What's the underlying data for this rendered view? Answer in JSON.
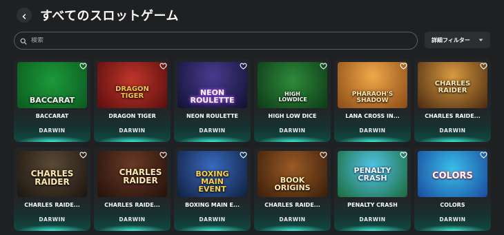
{
  "header": {
    "title": "すべてのスロットゲーム",
    "back_icon": "chevron-left-icon"
  },
  "search": {
    "placeholder": "検索",
    "value": "",
    "icon": "search-icon"
  },
  "filter": {
    "label": "詳細フィルター",
    "icon": "caret-down-icon"
  },
  "games": [
    {
      "name": "BACCARAT",
      "provider": "DARWIN",
      "logo": "BACCARAT",
      "color": "#ffffff"
    },
    {
      "name": "DRAGON TIGER",
      "provider": "DARWIN",
      "logo": "DRAGON TIGER",
      "color": "#f4c542"
    },
    {
      "name": "NEON ROULETTE",
      "provider": "DARWIN",
      "logo": "NEON ROULETTE",
      "color": "#ffffff"
    },
    {
      "name": "HIGH LOW DICE",
      "provider": "DARWIN",
      "logo": "HIGH LOWDICE",
      "color": "#ffffff"
    },
    {
      "name": "LANA CROSS IN...",
      "provider": "DARWIN",
      "logo": "PHARAOH'S SHADOW",
      "color": "#ffe9b0"
    },
    {
      "name": "CHARLES RAIDE...",
      "provider": "DARWIN",
      "logo": "CHARLES RAIDER",
      "color": "#ffe9b0"
    },
    {
      "name": "CHARLES RAIDE...",
      "provider": "DARWIN",
      "logo": "CHARLES RAIDER",
      "color": "#ffe9b0"
    },
    {
      "name": "CHARLES RAIDE...",
      "provider": "DARWIN",
      "logo": "CHARLES RAIDER",
      "color": "#ffe9b0"
    },
    {
      "name": "BOXING MAIN E...",
      "provider": "DARWIN",
      "logo": "BOXING MAIN EVENT",
      "color": "#ffd23f"
    },
    {
      "name": "CHARLES RAIDE...",
      "provider": "DARWIN",
      "logo": "BOOK ORIGINS",
      "color": "#ffe9b0"
    },
    {
      "name": "PENALTY CRASH",
      "provider": "DARWIN",
      "logo": "PENALTY CRASH",
      "color": "#ffffff"
    },
    {
      "name": "COLORS",
      "provider": "DARWIN",
      "logo": "COLORS",
      "color": "#ffffff"
    }
  ],
  "accent_color": "#3ff0d8",
  "favorite_icon": "heart-outline-icon"
}
